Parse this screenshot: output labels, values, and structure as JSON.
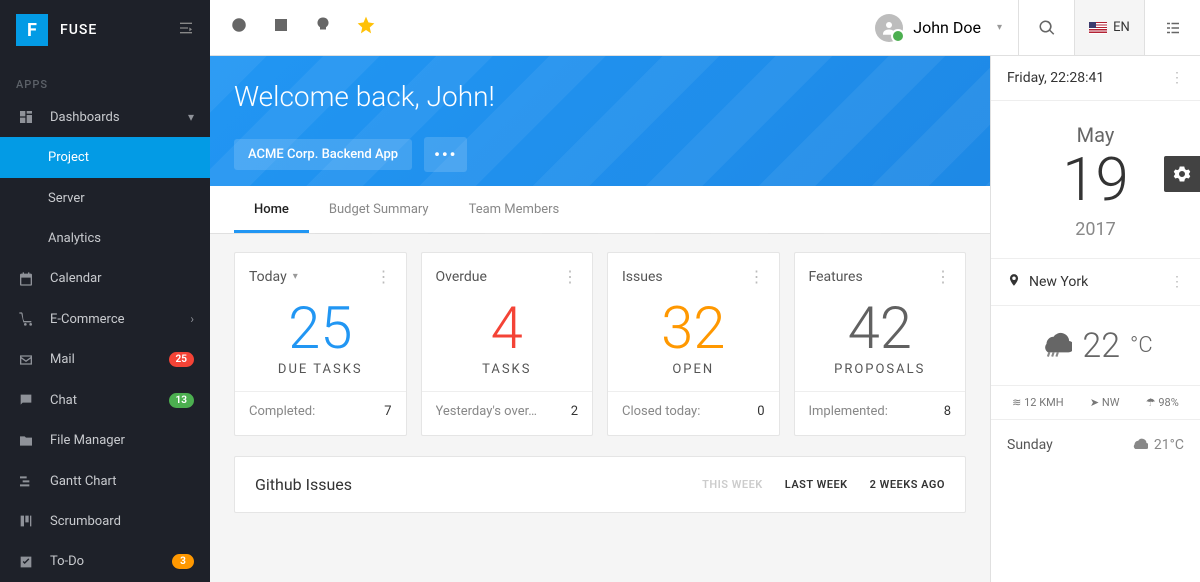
{
  "brand": "FUSE",
  "appsLabel": "APPS",
  "nav": {
    "dashboards": "Dashboards",
    "project": "Project",
    "server": "Server",
    "analytics": "Analytics",
    "calendar": "Calendar",
    "ecommerce": "E-Commerce",
    "mail": "Mail",
    "mailBadge": "25",
    "chat": "Chat",
    "chatBadge": "13",
    "fileManager": "File Manager",
    "gantt": "Gantt Chart",
    "scrumboard": "Scrumboard",
    "todo": "To-Do",
    "todoBadge": "3"
  },
  "user": {
    "name": "John Doe"
  },
  "lang": "EN",
  "hero": {
    "welcome": "Welcome back, John!",
    "project": "ACME Corp. Backend App"
  },
  "tabs": {
    "home": "Home",
    "budget": "Budget Summary",
    "team": "Team Members"
  },
  "cards": {
    "today": {
      "title": "Today",
      "value": "25",
      "label": "DUE TASKS",
      "footK": "Completed:",
      "footV": "7"
    },
    "overdue": {
      "title": "Overdue",
      "value": "4",
      "label": "TASKS",
      "footK": "Yesterday's over…",
      "footV": "2"
    },
    "issues": {
      "title": "Issues",
      "value": "32",
      "label": "OPEN",
      "footK": "Closed today:",
      "footV": "0"
    },
    "features": {
      "title": "Features",
      "value": "42",
      "label": "PROPOSALS",
      "footK": "Implemented:",
      "footV": "8"
    }
  },
  "github": {
    "title": "Github Issues",
    "thisWeek": "THIS WEEK",
    "lastWeek": "LAST WEEK",
    "twoWeeks": "2 WEEKS AGO"
  },
  "right": {
    "dateLine": "Friday, 22:28:41",
    "month": "May",
    "day": "19",
    "year": "2017",
    "city": "New York",
    "temp": "22",
    "unit": "°C",
    "wind": "12 KMH",
    "dir": "NW",
    "hum": "98%",
    "nextDay": "Sunday",
    "nextTemp": "21°C"
  }
}
